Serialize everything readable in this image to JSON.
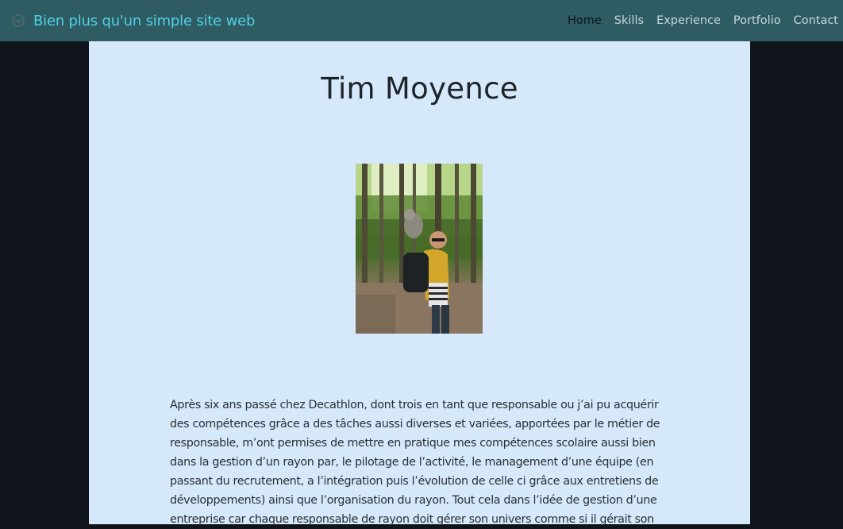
{
  "navbar": {
    "brand_icon": "circle-check-icon",
    "brand_text": "Bien plus qu'un simple site web",
    "links": [
      {
        "label": "Home",
        "active": true
      },
      {
        "label": "Skills",
        "active": false
      },
      {
        "label": "Experience",
        "active": false
      },
      {
        "label": "Portfolio",
        "active": false
      },
      {
        "label": "Contact",
        "active": false
      }
    ]
  },
  "main": {
    "title": "Tim Moyence",
    "photo_icon": "profile-photo",
    "bio": "Après six ans passé chez Decathlon, dont trois en tant que responsable ou j’ai pu acquérir des compétences grâce a des tâches aussi diverses et variées, apportées par le métier de responsable, m’ont permises de mettre en pratique mes compétences scolaire aussi bien dans la gestion d’un rayon par, le pilotage de l’activité, le management d’une équipe (en passant du recrutement, a l’intégration puis l’évolution de celle ci grâce aux entretiens de développements) ainsi que l’organisation du rayon. Tout cela dans l’idée de gestion d’une entreprise car chaque responsable de rayon doit gérer son univers comme si il gérait son"
  },
  "colors": {
    "navbar_bg": "#2f5b62",
    "brand": "#4fd1e6",
    "content_bg": "#d5e9fb",
    "page_bg": "#0f151b"
  }
}
